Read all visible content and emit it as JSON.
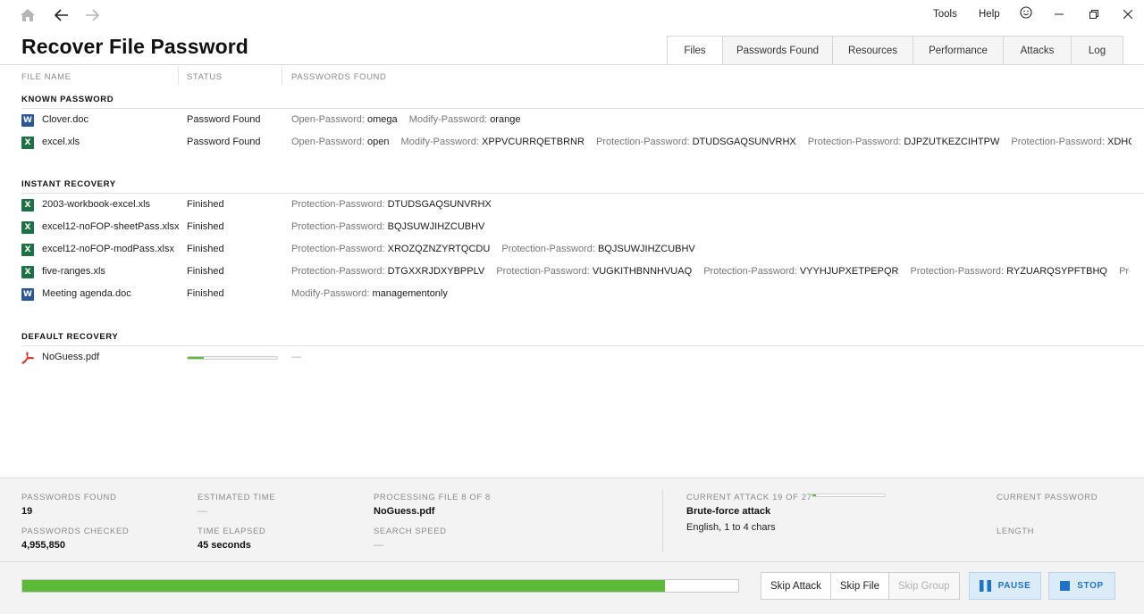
{
  "toolbar": {
    "tools_label": "Tools",
    "help_label": "Help"
  },
  "app": {
    "title": "Recover File Password"
  },
  "tabs": [
    {
      "label": "Files",
      "active": true
    },
    {
      "label": "Passwords Found",
      "active": false
    },
    {
      "label": "Resources",
      "active": false
    },
    {
      "label": "Performance",
      "active": false
    },
    {
      "label": "Attacks",
      "active": false
    },
    {
      "label": "Log",
      "active": false
    }
  ],
  "table": {
    "headers": {
      "file_name": "FILE NAME",
      "status": "STATUS",
      "passwords_found": "PASSWORDS FOUND"
    }
  },
  "sections": [
    {
      "title": "KNOWN PASSWORD",
      "rows": [
        {
          "icon": "word-doc-icon",
          "name": "Clover.doc",
          "status": "Password Found",
          "passwords": [
            {
              "label": "Open-Password:",
              "value": "omega"
            },
            {
              "label": "Modify-Password:",
              "value": "orange"
            }
          ]
        },
        {
          "icon": "excel-file-icon",
          "name": "excel.xls",
          "status": "Password Found",
          "passwords": [
            {
              "label": "Open-Password:",
              "value": "open"
            },
            {
              "label": "Modify-Password:",
              "value": "XPPVCURRQETBRNR"
            },
            {
              "label": "Protection-Password:",
              "value": "DTUDSGAQSUNVRHX"
            },
            {
              "label": "Protection-Password:",
              "value": "DJPZUTKEZCIHTPW"
            },
            {
              "label": "Protection-Password:",
              "value": "XDHQUPUPFMHKSI"
            }
          ]
        }
      ]
    },
    {
      "title": "INSTANT RECOVERY",
      "rows": [
        {
          "icon": "excel-file-icon",
          "name": "2003-workbook-excel.xls",
          "status": "Finished",
          "passwords": [
            {
              "label": "Protection-Password:",
              "value": "DTUDSGAQSUNVRHX"
            }
          ]
        },
        {
          "icon": "excel-file-icon",
          "name": "excel12-noFOP-sheetPass.xlsx",
          "status": "Finished",
          "passwords": [
            {
              "label": "Protection-Password:",
              "value": "BQJSUWJIHZCUBHV"
            }
          ]
        },
        {
          "icon": "excel-file-icon",
          "name": "excel12-noFOP-modPass.xlsx",
          "status": "Finished",
          "passwords": [
            {
              "label": "Protection-Password:",
              "value": "XROZQZNZYRTQCDU"
            },
            {
              "label": "Protection-Password:",
              "value": "BQJSUWJIHZCUBHV"
            }
          ]
        },
        {
          "icon": "excel-file-icon",
          "name": "five-ranges.xls",
          "status": "Finished",
          "passwords": [
            {
              "label": "Protection-Password:",
              "value": "DTGXXRJDXYBPPLV"
            },
            {
              "label": "Protection-Password:",
              "value": "VUGKITHBNNHVUAQ"
            },
            {
              "label": "Protection-Password:",
              "value": "VYYHJUPXETPEPQR"
            },
            {
              "label": "Protection-Password:",
              "value": "RYZUARQSYPFTBHQ"
            },
            {
              "label": "Protection-Passwor",
              "value": ""
            }
          ]
        },
        {
          "icon": "word-doc-icon",
          "name": "Meeting agenda.doc",
          "status": "Finished",
          "passwords": [
            {
              "label": "Modify-Password:",
              "value": "managementonly"
            }
          ]
        }
      ]
    },
    {
      "title": "DEFAULT RECOVERY",
      "rows": [
        {
          "icon": "pdf-file-icon",
          "name": "NoGuess.pdf",
          "status": "",
          "progress": 0.18,
          "passwords_placeholder": "—"
        }
      ]
    }
  ],
  "stats": {
    "passwords_found": {
      "label": "PASSWORDS FOUND",
      "value": "19"
    },
    "passwords_checked": {
      "label": "PASSWORDS CHECKED",
      "value": "4,955,850"
    },
    "estimated_time": {
      "label": "ESTIMATED TIME",
      "value": "—"
    },
    "time_elapsed": {
      "label": "TIME ELAPSED",
      "value": "45 seconds"
    },
    "processing_file": {
      "label": "PROCESSING FILE 8 OF 8",
      "value": "NoGuess.pdf"
    },
    "search_speed": {
      "label": "SEARCH SPEED",
      "value": "—"
    },
    "current_attack": {
      "label": "CURRENT ATTACK 19 OF 27",
      "value": "Brute-force attack",
      "detail": "English, 1 to 4 chars",
      "progress": 0.05
    },
    "current_password": {
      "label": "CURRENT PASSWORD"
    },
    "length": {
      "label": "LENGTH"
    }
  },
  "footer": {
    "overall_progress": 0.898,
    "skip_attack_label": "Skip Attack",
    "skip_file_label": "Skip File",
    "skip_group_label": "Skip Group",
    "pause_label": "PAUSE",
    "stop_label": "STOP"
  },
  "colors": {
    "accent_green": "#5bbb39",
    "accent_blue": "#1d73c9",
    "word_blue": "#2b5797",
    "excel_green": "#1e7145",
    "pdf_red": "#d9342b"
  }
}
